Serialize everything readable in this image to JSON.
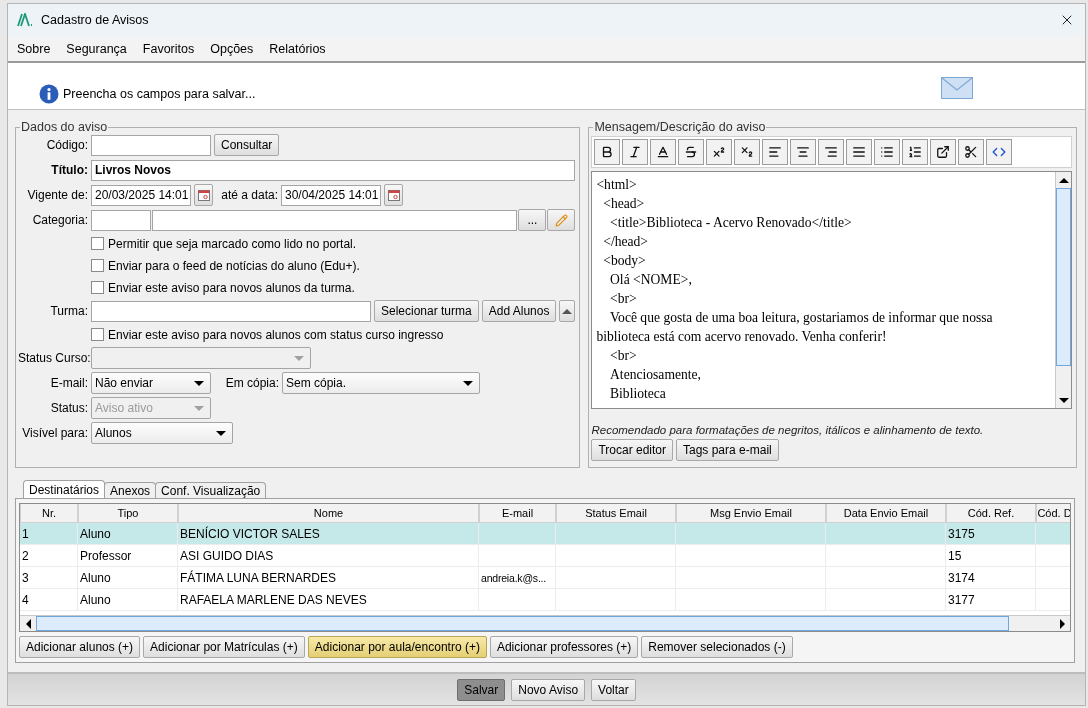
{
  "window": {
    "title": "Cadastro de Avisos"
  },
  "menu": [
    "Sobre",
    "Segurança",
    "Favoritos",
    "Opções",
    "Relatórios"
  ],
  "info": {
    "message": "Preencha os campos para salvar..."
  },
  "details": {
    "legend": "Dados do aviso",
    "code": {
      "label": "Código:",
      "button": "Consultar"
    },
    "title": {
      "label": "Título:",
      "value": "Livros Novos"
    },
    "valid_from": {
      "label": "Vigente de:",
      "value": "20/03/2025 14:01"
    },
    "valid_to": {
      "label": "até a data:",
      "value": "30/04/2025 14:01"
    },
    "category": {
      "label": "Categoria:",
      "button": "..."
    },
    "options": [
      {
        "label": "Permitir que seja marcado como lido no portal.",
        "checked": false
      },
      {
        "label": "Enviar para o feed de notícias do aluno (Edu+).",
        "checked": false
      },
      {
        "label": "Enviar este aviso para novos alunos da turma.",
        "checked": false
      }
    ],
    "class_group": {
      "label": "Turma:",
      "buttons": [
        "Selecionar turma",
        "Add Alunos"
      ]
    },
    "ingress_option": {
      "label": "Enviar este aviso para novos alunos com status curso ingresso",
      "checked": false
    },
    "course_status": {
      "label": "Status Curso:",
      "disabled": true
    },
    "email": {
      "label": "E-mail:",
      "value": "Não enviar",
      "disabled": false
    },
    "copy": {
      "label": "Em cópia:",
      "value": "Sem cópia.",
      "disabled": false
    },
    "status": {
      "label": "Status:",
      "value": "Aviso ativo",
      "disabled": true
    },
    "visible_to": {
      "label": "Visível para:",
      "value": "Alunos",
      "disabled": false
    }
  },
  "message": {
    "legend": "Mensagem/Descrição do aviso",
    "lines": [
      "<html>",
      "  <head>",
      "    <title>Biblioteca - Acervo Renovado</title>",
      "  </head>",
      "  <body>",
      "    Olá <NOME>,",
      "    <br>",
      "    Você que gosta de uma boa leitura, gostariamos de informar que nossa biblioteca está com acervo renovado. Venha conferir!",
      "    <br>",
      "    Atenciosamente,",
      "    Biblioteca"
    ],
    "hint": "Recomendado para formatações de negritos, itálicos e alinhamento de texto.",
    "buttons": [
      "Trocar editor",
      "Tags para e-mail"
    ]
  },
  "tabs": [
    {
      "label": "Destinatários",
      "selected": true
    },
    {
      "label": "Anexos",
      "selected": false
    },
    {
      "label": "Conf. Visualização",
      "selected": false
    }
  ],
  "table": {
    "columns": [
      "Nr.",
      "Tipo",
      "Nome",
      "E-mail",
      "Status Email",
      "Msg Envio Email",
      "Data Envio Email",
      "Cód. Ref.",
      "Cód. D"
    ],
    "rows": [
      {
        "nr": "1",
        "type": "Aluno",
        "name": "BENÍCIO VICTOR SALES",
        "ref": "3175",
        "selected": true
      },
      {
        "nr": "2",
        "type": "Professor",
        "name": "ASI GUIDO DIAS",
        "ref": "15",
        "selected": false
      },
      {
        "nr": "3",
        "type": "Aluno",
        "name": "FÁTIMA LUNA BERNARDES",
        "email": "andreia.k@s...",
        "ref": "3174",
        "selected": false
      },
      {
        "nr": "4",
        "type": "Aluno",
        "name": "RAFAELA MARLENE DAS NEVES",
        "ref": "3177",
        "selected": false
      }
    ]
  },
  "actions": [
    {
      "label": "Adicionar alunos (+)",
      "highlighted": false
    },
    {
      "label": "Adicionar por Matrículas (+)",
      "highlighted": false
    },
    {
      "label": "Adicionar por aula/encontro (+)",
      "highlighted": true
    },
    {
      "label": "Adicionar professores (+)",
      "highlighted": false
    },
    {
      "label": "Remover selecionados (-)",
      "highlighted": false
    }
  ],
  "footer": [
    {
      "label": "Salvar",
      "default": true
    },
    {
      "label": "Novo Aviso",
      "default": false
    },
    {
      "label": "Voltar",
      "default": false
    }
  ]
}
